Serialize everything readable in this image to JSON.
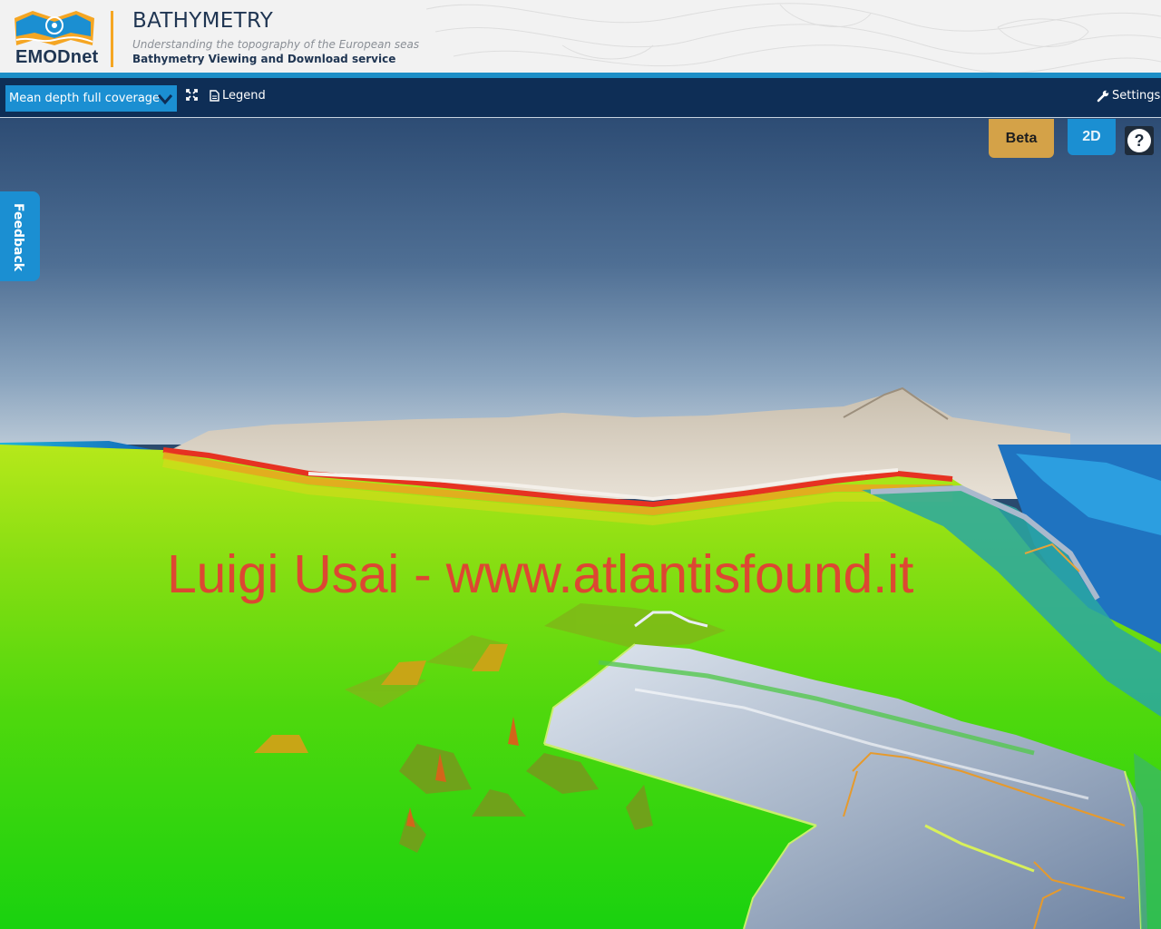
{
  "header": {
    "logo_text": "EMODnet",
    "title": "BATHYMETRY",
    "subtitle": "Understanding the topography of the European seas",
    "service": "Bathymetry Viewing and Download service"
  },
  "toolbar": {
    "layer_select": "Mean depth full coverage",
    "fullscreen_icon": "expand-icon",
    "legend_label": "Legend",
    "settings_label": "Settings"
  },
  "map": {
    "watermark": "Luigi Usai - www.atlantisfound.it",
    "feedback_label": "Feedback",
    "beta_label": "Beta",
    "view_toggle_label": "2D",
    "help_label": "?"
  },
  "colors": {
    "header_bg": "#f2f2f2",
    "accent_orange": "#f5a623",
    "toolbar_bg": "#0e2e56",
    "accent_blue": "#1b8fd2",
    "beta_gold": "#d4a248",
    "watermark_red": "#e53b35"
  }
}
